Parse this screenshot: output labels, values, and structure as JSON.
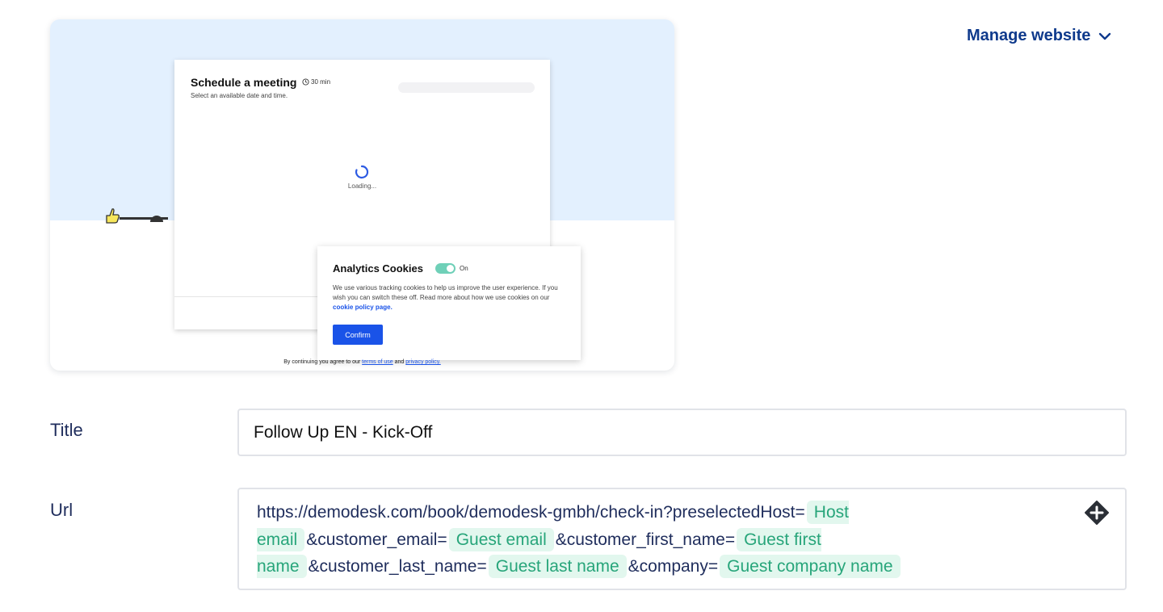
{
  "preview": {
    "meeting_title": "Schedule a meeting",
    "meeting_duration": "30 min",
    "meeting_subtitle": "Select an available date and time.",
    "loading_text": "Loading...",
    "cookie_title": "Analytics Cookies",
    "cookie_toggle_label": "On",
    "cookie_text": "We use various tracking cookies to help us improve the user experience. If you wish you can switch these off. Read more about how we use cookies on our",
    "cookie_link": "cookie policy page.",
    "confirm_label": "Confirm",
    "terms_prefix": "By continuing you agree to our",
    "terms_link": "terms of use",
    "terms_and": "and",
    "privacy_link": "privacy policy."
  },
  "header": {
    "manage_label": "Manage website"
  },
  "form": {
    "title_label": "Title",
    "title_value": "Follow Up EN - Kick-Off",
    "url_label": "Url",
    "url_parts": [
      {
        "text": "https://demodesk.com/book/demodesk-gmbh/check-in?preselectedHost="
      },
      {
        "chip": "Host email"
      },
      {
        "text": "&customer_email="
      },
      {
        "chip": "Guest email"
      },
      {
        "text": "&customer_first_name="
      },
      {
        "chip": "Guest first name"
      },
      {
        "text": "&customer_last_name="
      },
      {
        "chip": "Guest last name"
      },
      {
        "text": "&company="
      },
      {
        "chip": "Guest company name"
      }
    ]
  },
  "colors": {
    "accent_blue": "#0f3a8c",
    "chip_bg": "#e2f7ee",
    "chip_text": "#27a57a",
    "confirm_blue": "#1a53e8"
  },
  "icons": {
    "manage_chevron": "chevron-down-icon",
    "url_action": "move-icon",
    "duration": "clock-icon"
  }
}
